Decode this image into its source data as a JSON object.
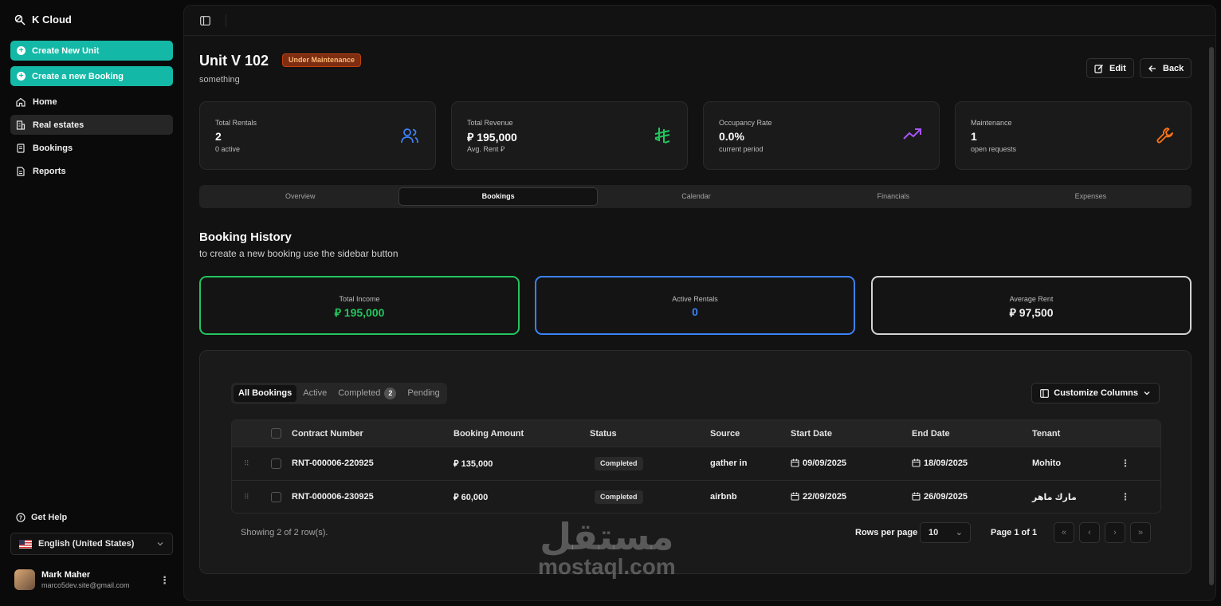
{
  "app": {
    "name": "K Cloud"
  },
  "sidebar": {
    "cta": [
      {
        "label": "Create New Unit"
      },
      {
        "label": "Create a new Booking"
      }
    ],
    "items": [
      {
        "label": "Home",
        "icon": "home-icon"
      },
      {
        "label": "Real estates",
        "icon": "building-icon"
      },
      {
        "label": "Bookings",
        "icon": "book-icon"
      },
      {
        "label": "Reports",
        "icon": "report-icon"
      }
    ],
    "help_label": "Get Help",
    "language": "English (United States)",
    "user": {
      "name": "Mark Maher",
      "email": "marco5dev.site@gmail.com"
    }
  },
  "header": {
    "title": "Unit V 102",
    "status_badge": "Under Maintenance",
    "subtitle": "something",
    "edit_label": "Edit",
    "back_label": "Back"
  },
  "stats": [
    {
      "label": "Total Rentals",
      "value": "2",
      "sub": "0 active",
      "icon": "users-icon",
      "color": "#3b82f6"
    },
    {
      "label": "Total Revenue",
      "value": "⃁ 195,000",
      "sub": "Avg. Rent ⃁",
      "icon": "riyal-icon",
      "color": "#22c55e"
    },
    {
      "label": "Occupancy Rate",
      "value": "0.0%",
      "sub": "current period",
      "icon": "trending-up-icon",
      "color": "#a855f7"
    },
    {
      "label": "Maintenance",
      "value": "1",
      "sub": "open requests",
      "icon": "wrench-icon",
      "color": "#f97316"
    }
  ],
  "tabs": [
    "Overview",
    "Bookings",
    "Calendar",
    "Financials",
    "Expenses"
  ],
  "active_tab": "Bookings",
  "section": {
    "title": "Booking History",
    "subtitle": "to create a new booking use the sidebar button"
  },
  "summary": [
    {
      "label": "Total Income",
      "value": "⃁ 195,000",
      "color": "#22c55e"
    },
    {
      "label": "Active Rentals",
      "value": "0",
      "color": "#3b82f6"
    },
    {
      "label": "Average Rent",
      "value": "⃁ 97,500",
      "color": "#d4d4d4"
    }
  ],
  "filters": {
    "tabs": [
      "All Bookings",
      "Active",
      "Completed",
      "Pending"
    ],
    "completed_count": "2",
    "customize_label": "Customize Columns"
  },
  "table": {
    "columns": [
      "Contract Number",
      "Booking Amount",
      "Status",
      "Source",
      "Start Date",
      "End Date",
      "Tenant"
    ],
    "rows": [
      {
        "contract": "RNT-000006-220925",
        "amount": "⃁ 135,000",
        "status": "Completed",
        "source": "gather in",
        "start": "09/09/2025",
        "end": "18/09/2025",
        "tenant": "Mohito"
      },
      {
        "contract": "RNT-000006-230925",
        "amount": "⃁ 60,000",
        "status": "Completed",
        "source": "airbnb",
        "start": "22/09/2025",
        "end": "26/09/2025",
        "tenant": "مارك ماهر"
      }
    ]
  },
  "pagination": {
    "showing": "Showing 2 of 2 row(s).",
    "rows_per_page_label": "Rows per page",
    "rows_per_page": "10",
    "page_label": "Page 1 of 1"
  },
  "watermark": {
    "arabic": "مستقل",
    "latin": "mostaql.com"
  }
}
